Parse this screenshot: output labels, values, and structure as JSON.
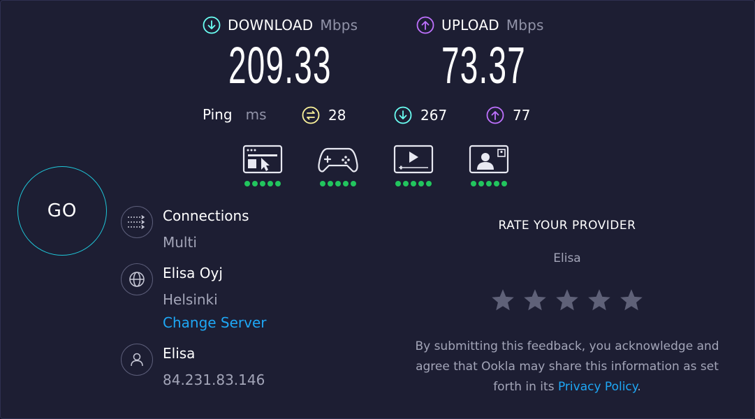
{
  "download": {
    "label": "DOWNLOAD",
    "unit": "Mbps",
    "value": "209.33",
    "icon": "arrow-down-circle-icon",
    "color": "#6afff3"
  },
  "upload": {
    "label": "UPLOAD",
    "unit": "Mbps",
    "value": "73.37",
    "icon": "arrow-up-circle-icon",
    "color": "#bf71ff"
  },
  "ping": {
    "label": "Ping",
    "unit": "ms",
    "idle": "28",
    "download": "267",
    "upload": "77",
    "idle_color": "#fbf39a",
    "download_color": "#6afff3",
    "upload_color": "#bf71ff"
  },
  "quality": {
    "items": [
      {
        "icon": "web-browsing-icon",
        "rating": 5
      },
      {
        "icon": "gaming-controller-icon",
        "rating": 5
      },
      {
        "icon": "video-streaming-icon",
        "rating": 5
      },
      {
        "icon": "video-chat-icon",
        "rating": 5
      }
    ],
    "dot_color": "#22c55e"
  },
  "go_button": {
    "label": "GO",
    "ring_color": "#1fc7d9"
  },
  "connections": {
    "title": "Connections",
    "value": "Multi"
  },
  "server": {
    "name": "Elisa Oyj",
    "location": "Helsinki",
    "change_label": "Change Server"
  },
  "isp": {
    "name": "Elisa",
    "ip": "84.231.83.146"
  },
  "rate": {
    "title": "RATE YOUR PROVIDER",
    "provider": "Elisa",
    "stars": 5,
    "disclaimer_line1": "By submitting this feedback, you acknowledge and",
    "disclaimer_line2": "agree that Ookla may share this information as set",
    "disclaimer_line3_prefix": "forth in its ",
    "privacy_link": "Privacy Policy",
    "disclaimer_suffix": "."
  },
  "colors": {
    "background": "#1d1e33",
    "link": "#1ea7f5",
    "muted_text": "#a3a5b8"
  }
}
